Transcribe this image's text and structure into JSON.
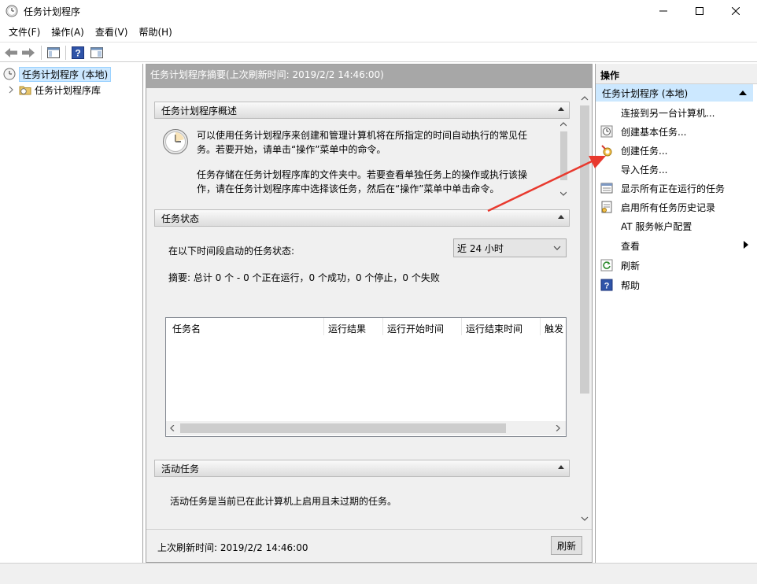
{
  "window": {
    "title": "任务计划程序",
    "minimize_icon": "minimize-icon",
    "maximize_icon": "maximize-icon",
    "close_icon": "close-icon"
  },
  "menu": [
    "文件(F)",
    "操作(A)",
    "查看(V)",
    "帮助(H)"
  ],
  "tree": {
    "root": "任务计划程序 (本地)",
    "child": "任务计划程序库"
  },
  "center": {
    "header": "任务计划程序摘要(上次刷新时间: 2019/2/2 14:46:00)",
    "overview": {
      "title": "任务计划程序概述",
      "p1_line1": "可以使用任务计划程序来创建和管理计算机将在所指定的时间自动执行的常见任",
      "p1_line2": "务。若要开始，请单击“操作”菜单中的命令。",
      "p2_line1": "任务存储在任务计划程序库的文件夹中。若要查看单独任务上的操作或执行该操",
      "p2_line2": "作，请在任务计划程序库中选择该任务，然后在“操作”菜单中单击命令。"
    },
    "status": {
      "title": "任务状态",
      "period_label": "在以下时间段启动的任务状态:",
      "period_value": "近 24 小时",
      "summary": "摘要: 总计 0 个 - 0 个正在运行，0 个成功，0 个停止，0 个失败",
      "columns": [
        "任务名",
        "运行结果",
        "运行开始时间",
        "运行结束时间",
        "触发"
      ]
    },
    "active": {
      "title": "活动任务",
      "desc": "活动任务是当前已在此计算机上启用且未过期的任务。"
    },
    "footer": {
      "last_refresh": "上次刷新时间: 2019/2/2 14:46:00",
      "refresh_button": "刷新"
    }
  },
  "actions": {
    "header": "操作",
    "section": "任务计划程序 (本地)",
    "items": [
      {
        "label": "连接到另一台计算机...",
        "icon": ""
      },
      {
        "label": "创建基本任务...",
        "icon": "clock-task-icon"
      },
      {
        "label": "创建任务...",
        "icon": "create-task-icon"
      },
      {
        "label": "导入任务...",
        "icon": ""
      },
      {
        "label": "显示所有正在运行的任务",
        "icon": "running-tasks-icon"
      },
      {
        "label": "启用所有任务历史记录",
        "icon": "history-icon"
      },
      {
        "label": "AT 服务帐户配置",
        "icon": ""
      },
      {
        "label": "查看",
        "icon": ""
      },
      {
        "label": "刷新",
        "icon": "refresh-icon"
      },
      {
        "label": "帮助",
        "icon": "help-icon"
      }
    ]
  },
  "colors": {
    "selection": "#cce8ff",
    "header_gray": "#a7a7a7",
    "annotation_arrow": "#e8392e"
  }
}
